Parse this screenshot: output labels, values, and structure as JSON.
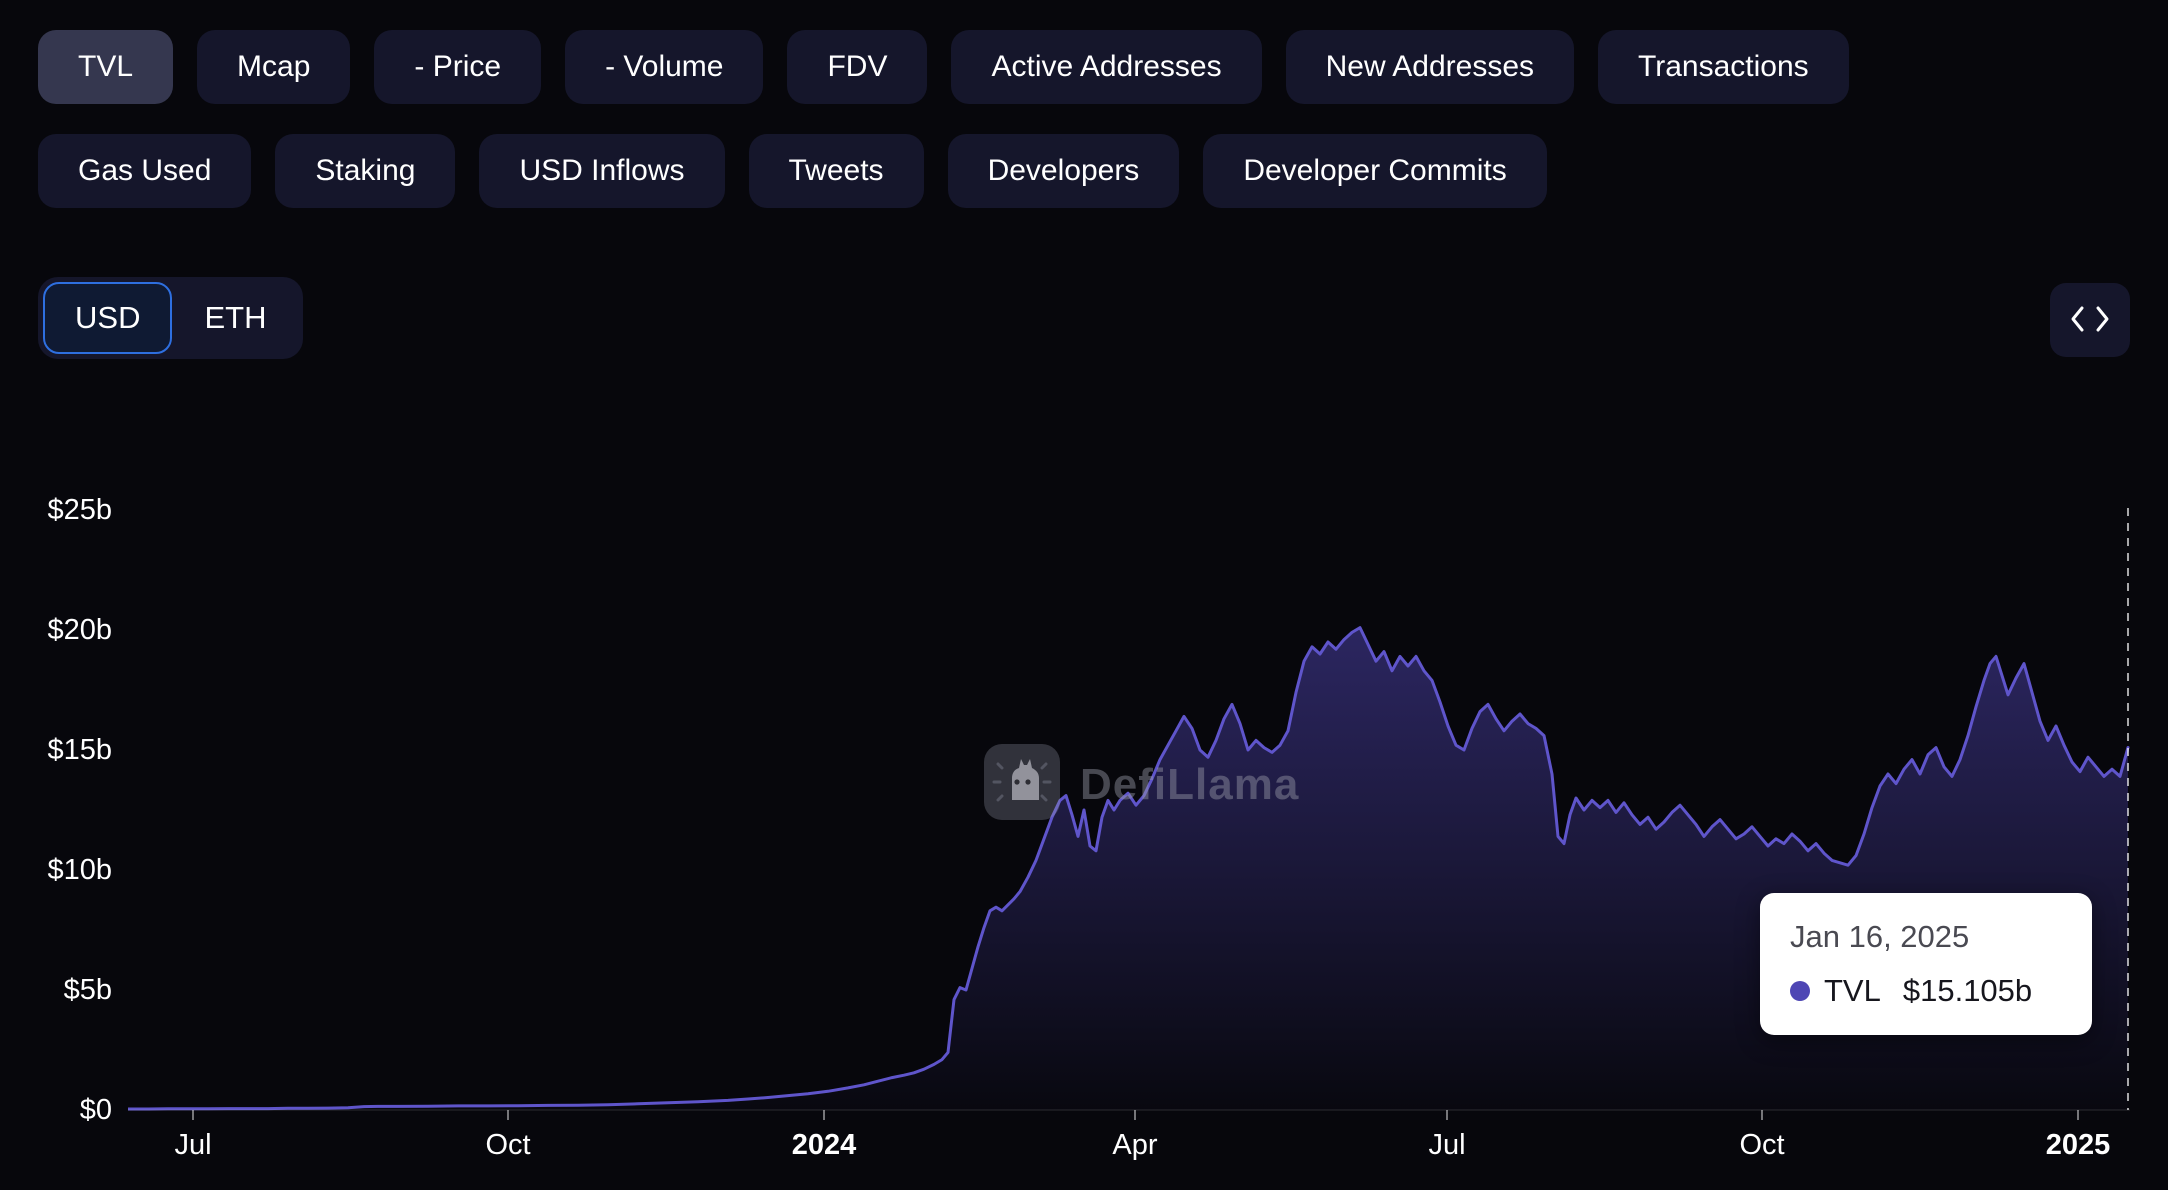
{
  "tabs": {
    "row1": [
      {
        "label": "TVL",
        "selected": true
      },
      {
        "label": "Mcap",
        "selected": false
      },
      {
        "label": "- Price",
        "selected": false
      },
      {
        "label": "- Volume",
        "selected": false
      },
      {
        "label": "FDV",
        "selected": false
      },
      {
        "label": "Active Addresses",
        "selected": false
      },
      {
        "label": "New Addresses",
        "selected": false
      },
      {
        "label": "Transactions",
        "selected": false
      }
    ],
    "row2": [
      {
        "label": "Gas Used",
        "selected": false
      },
      {
        "label": "Staking",
        "selected": false
      },
      {
        "label": "USD Inflows",
        "selected": false
      },
      {
        "label": "Tweets",
        "selected": false
      },
      {
        "label": "Developers",
        "selected": false
      },
      {
        "label": "Developer Commits",
        "selected": false
      }
    ]
  },
  "currency_toggle": {
    "options": [
      {
        "label": "USD",
        "selected": true
      },
      {
        "label": "ETH",
        "selected": false
      }
    ],
    "accent_color": "#2e6fe0"
  },
  "embed_button": {
    "icon": "code-icon"
  },
  "watermark": {
    "text": "DefiLlama"
  },
  "tooltip": {
    "date": "Jan 16, 2025",
    "series": "TVL",
    "value": "$15.105b",
    "dot_color": "#4e46b4"
  },
  "chart_data": {
    "type": "area",
    "series_name": "TVL",
    "unit": "billions USD",
    "ylim": [
      0,
      25
    ],
    "y_ticks": [
      {
        "value": 25,
        "label": "$25b"
      },
      {
        "value": 20,
        "label": "$20b"
      },
      {
        "value": 15,
        "label": "$15b"
      },
      {
        "value": 10,
        "label": "$10b"
      },
      {
        "value": 5,
        "label": "$5b"
      },
      {
        "value": 0,
        "label": "$0"
      }
    ],
    "x_ticks": [
      {
        "label": "Jul",
        "t": 0.0325,
        "bold": false
      },
      {
        "label": "Oct",
        "t": 0.19,
        "bold": false
      },
      {
        "label": "2024",
        "t": 0.348,
        "bold": true
      },
      {
        "label": "Apr",
        "t": 0.5035,
        "bold": false
      },
      {
        "label": "Jul",
        "t": 0.6595,
        "bold": false
      },
      {
        "label": "Oct",
        "t": 0.817,
        "bold": false
      },
      {
        "label": "2025",
        "t": 0.975,
        "bold": true
      }
    ],
    "line_color": "#5f55cb",
    "area_top_color": "rgba(88,76,199,0.45)",
    "area_bottom_color": "rgba(88,76,199,0.02)",
    "cursor_line_t": 1.0,
    "last_point": {
      "date": "Jan 16, 2025",
      "value_b": 15.105
    },
    "series": [
      {
        "name": "TVL",
        "points": [
          [
            0.0,
            0.04
          ],
          [
            0.01,
            0.04
          ],
          [
            0.02,
            0.05
          ],
          [
            0.03,
            0.05
          ],
          [
            0.04,
            0.05
          ],
          [
            0.05,
            0.06
          ],
          [
            0.06,
            0.06
          ],
          [
            0.07,
            0.06
          ],
          [
            0.08,
            0.07
          ],
          [
            0.09,
            0.07
          ],
          [
            0.1,
            0.08
          ],
          [
            0.11,
            0.09
          ],
          [
            0.118,
            0.14
          ],
          [
            0.125,
            0.15
          ],
          [
            0.135,
            0.15
          ],
          [
            0.15,
            0.16
          ],
          [
            0.165,
            0.17
          ],
          [
            0.18,
            0.17
          ],
          [
            0.195,
            0.18
          ],
          [
            0.21,
            0.19
          ],
          [
            0.225,
            0.2
          ],
          [
            0.24,
            0.22
          ],
          [
            0.255,
            0.26
          ],
          [
            0.27,
            0.3
          ],
          [
            0.285,
            0.34
          ],
          [
            0.3,
            0.4
          ],
          [
            0.31,
            0.46
          ],
          [
            0.32,
            0.52
          ],
          [
            0.33,
            0.6
          ],
          [
            0.34,
            0.68
          ],
          [
            0.35,
            0.78
          ],
          [
            0.36,
            0.92
          ],
          [
            0.368,
            1.05
          ],
          [
            0.375,
            1.2
          ],
          [
            0.382,
            1.35
          ],
          [
            0.388,
            1.45
          ],
          [
            0.393,
            1.55
          ],
          [
            0.398,
            1.7
          ],
          [
            0.403,
            1.9
          ],
          [
            0.407,
            2.1
          ],
          [
            0.41,
            2.4
          ],
          [
            0.413,
            4.6
          ],
          [
            0.416,
            5.1
          ],
          [
            0.419,
            5.0
          ],
          [
            0.422,
            5.9
          ],
          [
            0.425,
            6.8
          ],
          [
            0.428,
            7.6
          ],
          [
            0.431,
            8.3
          ],
          [
            0.434,
            8.45
          ],
          [
            0.437,
            8.3
          ],
          [
            0.44,
            8.55
          ],
          [
            0.443,
            8.8
          ],
          [
            0.446,
            9.1
          ],
          [
            0.45,
            9.7
          ],
          [
            0.454,
            10.4
          ],
          [
            0.458,
            11.3
          ],
          [
            0.462,
            12.2
          ],
          [
            0.466,
            12.9
          ],
          [
            0.469,
            13.1
          ],
          [
            0.472,
            12.3
          ],
          [
            0.475,
            11.4
          ],
          [
            0.478,
            12.5
          ],
          [
            0.481,
            11.0
          ],
          [
            0.484,
            10.8
          ],
          [
            0.487,
            12.2
          ],
          [
            0.49,
            12.9
          ],
          [
            0.493,
            12.5
          ],
          [
            0.496,
            12.9
          ],
          [
            0.5,
            13.2
          ],
          [
            0.504,
            12.7
          ],
          [
            0.508,
            13.1
          ],
          [
            0.512,
            13.8
          ],
          [
            0.516,
            14.6
          ],
          [
            0.52,
            15.2
          ],
          [
            0.524,
            15.8
          ],
          [
            0.528,
            16.4
          ],
          [
            0.532,
            15.9
          ],
          [
            0.536,
            15.0
          ],
          [
            0.54,
            14.7
          ],
          [
            0.544,
            15.4
          ],
          [
            0.548,
            16.3
          ],
          [
            0.552,
            16.9
          ],
          [
            0.556,
            16.1
          ],
          [
            0.56,
            15.0
          ],
          [
            0.564,
            15.4
          ],
          [
            0.568,
            15.1
          ],
          [
            0.572,
            14.9
          ],
          [
            0.576,
            15.2
          ],
          [
            0.58,
            15.8
          ],
          [
            0.584,
            17.4
          ],
          [
            0.588,
            18.7
          ],
          [
            0.592,
            19.3
          ],
          [
            0.596,
            19.0
          ],
          [
            0.6,
            19.5
          ],
          [
            0.604,
            19.2
          ],
          [
            0.608,
            19.6
          ],
          [
            0.612,
            19.9
          ],
          [
            0.616,
            20.1
          ],
          [
            0.62,
            19.4
          ],
          [
            0.624,
            18.7
          ],
          [
            0.628,
            19.1
          ],
          [
            0.632,
            18.3
          ],
          [
            0.636,
            18.9
          ],
          [
            0.64,
            18.5
          ],
          [
            0.644,
            18.9
          ],
          [
            0.648,
            18.3
          ],
          [
            0.652,
            17.9
          ],
          [
            0.656,
            17.0
          ],
          [
            0.66,
            16.0
          ],
          [
            0.664,
            15.2
          ],
          [
            0.668,
            15.0
          ],
          [
            0.672,
            15.9
          ],
          [
            0.676,
            16.6
          ],
          [
            0.68,
            16.9
          ],
          [
            0.684,
            16.3
          ],
          [
            0.688,
            15.8
          ],
          [
            0.692,
            16.2
          ],
          [
            0.696,
            16.5
          ],
          [
            0.7,
            16.1
          ],
          [
            0.704,
            15.9
          ],
          [
            0.708,
            15.6
          ],
          [
            0.712,
            14.0
          ],
          [
            0.715,
            11.4
          ],
          [
            0.718,
            11.1
          ],
          [
            0.721,
            12.3
          ],
          [
            0.724,
            13.0
          ],
          [
            0.728,
            12.5
          ],
          [
            0.732,
            12.9
          ],
          [
            0.736,
            12.6
          ],
          [
            0.74,
            12.9
          ],
          [
            0.744,
            12.4
          ],
          [
            0.748,
            12.8
          ],
          [
            0.752,
            12.3
          ],
          [
            0.756,
            11.9
          ],
          [
            0.76,
            12.2
          ],
          [
            0.764,
            11.7
          ],
          [
            0.768,
            12.0
          ],
          [
            0.772,
            12.4
          ],
          [
            0.776,
            12.7
          ],
          [
            0.78,
            12.3
          ],
          [
            0.784,
            11.9
          ],
          [
            0.788,
            11.4
          ],
          [
            0.792,
            11.8
          ],
          [
            0.796,
            12.1
          ],
          [
            0.8,
            11.7
          ],
          [
            0.804,
            11.3
          ],
          [
            0.808,
            11.5
          ],
          [
            0.812,
            11.8
          ],
          [
            0.816,
            11.4
          ],
          [
            0.82,
            11.0
          ],
          [
            0.824,
            11.3
          ],
          [
            0.828,
            11.1
          ],
          [
            0.832,
            11.5
          ],
          [
            0.836,
            11.2
          ],
          [
            0.84,
            10.8
          ],
          [
            0.844,
            11.1
          ],
          [
            0.848,
            10.7
          ],
          [
            0.852,
            10.4
          ],
          [
            0.856,
            10.3
          ],
          [
            0.86,
            10.2
          ],
          [
            0.864,
            10.6
          ],
          [
            0.868,
            11.5
          ],
          [
            0.872,
            12.6
          ],
          [
            0.876,
            13.5
          ],
          [
            0.88,
            14.0
          ],
          [
            0.884,
            13.6
          ],
          [
            0.888,
            14.2
          ],
          [
            0.892,
            14.6
          ],
          [
            0.896,
            14.0
          ],
          [
            0.9,
            14.8
          ],
          [
            0.904,
            15.1
          ],
          [
            0.908,
            14.3
          ],
          [
            0.912,
            13.9
          ],
          [
            0.916,
            14.6
          ],
          [
            0.92,
            15.6
          ],
          [
            0.924,
            16.8
          ],
          [
            0.928,
            17.9
          ],
          [
            0.931,
            18.6
          ],
          [
            0.934,
            18.9
          ],
          [
            0.937,
            18.1
          ],
          [
            0.94,
            17.3
          ],
          [
            0.944,
            18.0
          ],
          [
            0.948,
            18.6
          ],
          [
            0.952,
            17.4
          ],
          [
            0.956,
            16.2
          ],
          [
            0.96,
            15.4
          ],
          [
            0.964,
            16.0
          ],
          [
            0.968,
            15.2
          ],
          [
            0.972,
            14.5
          ],
          [
            0.976,
            14.1
          ],
          [
            0.98,
            14.7
          ],
          [
            0.984,
            14.3
          ],
          [
            0.988,
            13.9
          ],
          [
            0.992,
            14.2
          ],
          [
            0.996,
            13.9
          ],
          [
            1.0,
            15.105
          ]
        ]
      }
    ]
  }
}
